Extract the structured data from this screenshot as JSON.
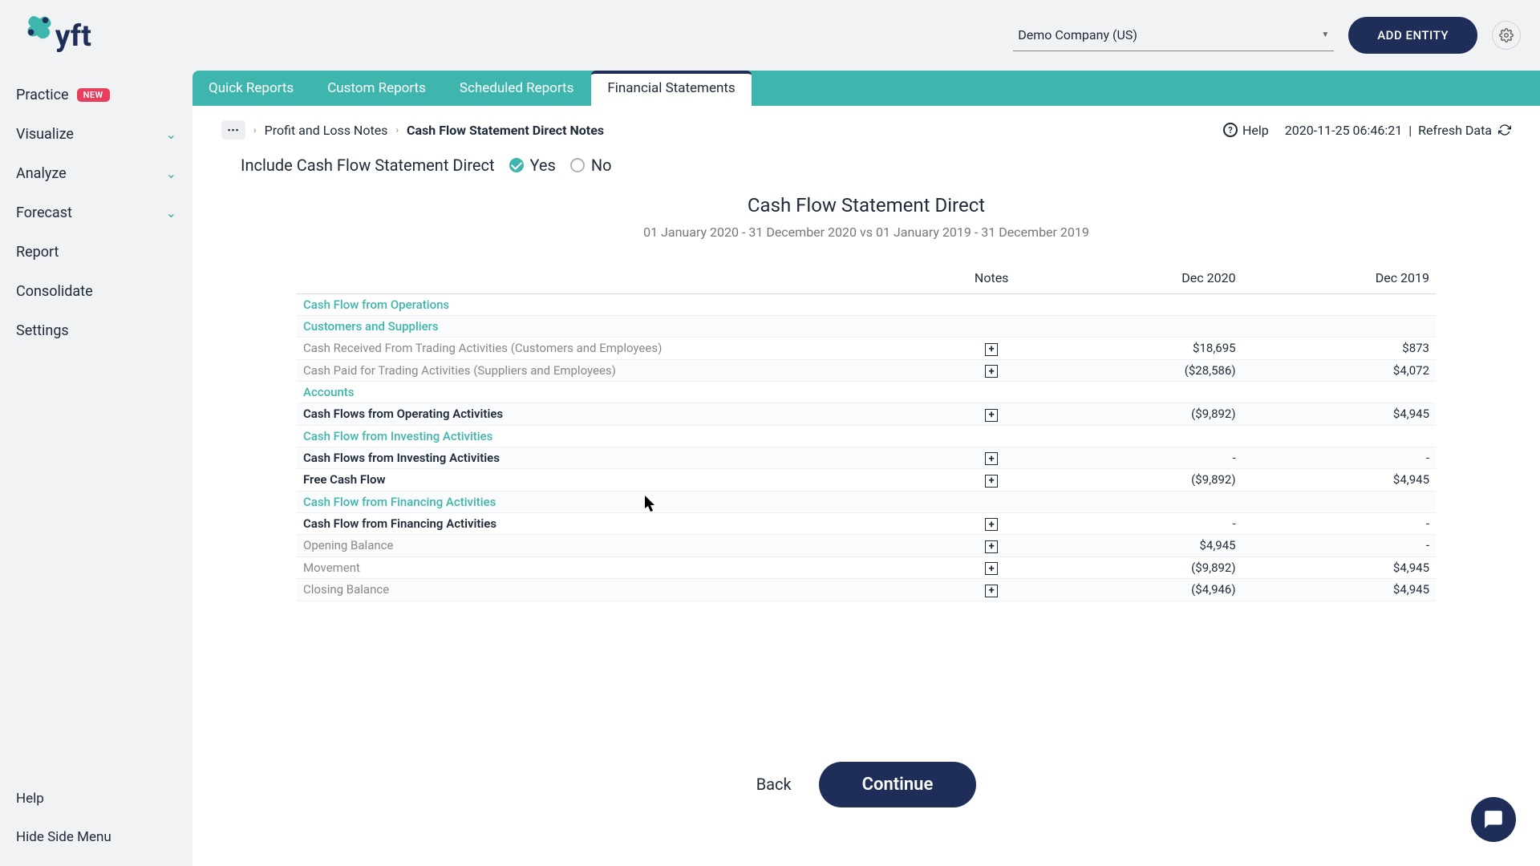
{
  "header": {
    "entity_selected": "Demo Company (US)",
    "add_entity_label": "ADD ENTITY"
  },
  "sidebar": {
    "items": [
      {
        "label": "Practice",
        "badge": "NEW",
        "chev": false
      },
      {
        "label": "Visualize",
        "badge": null,
        "chev": true
      },
      {
        "label": "Analyze",
        "badge": null,
        "chev": true
      },
      {
        "label": "Forecast",
        "badge": null,
        "chev": true
      },
      {
        "label": "Report",
        "badge": null,
        "chev": false
      },
      {
        "label": "Consolidate",
        "badge": null,
        "chev": false
      },
      {
        "label": "Settings",
        "badge": null,
        "chev": false
      }
    ],
    "help_label": "Help",
    "hide_label": "Hide Side Menu"
  },
  "tabs": [
    {
      "label": "Quick Reports",
      "active": false
    },
    {
      "label": "Custom Reports",
      "active": false
    },
    {
      "label": "Scheduled Reports",
      "active": false
    },
    {
      "label": "Financial Statements",
      "active": true
    }
  ],
  "breadcrumbs": {
    "prev": "Profit and Loss Notes",
    "current": "Cash Flow Statement Direct Notes"
  },
  "topbar": {
    "help_label": "Help",
    "timestamp": "2020-11-25 06:46:21",
    "refresh_label": "Refresh Data"
  },
  "include": {
    "label": "Include Cash Flow Statement Direct",
    "yes": "Yes",
    "no": "No",
    "selected": "yes"
  },
  "report": {
    "title": "Cash Flow Statement Direct",
    "period": "01 January 2020 - 31 December 2020 vs 01 January 2019 - 31 December 2019"
  },
  "table": {
    "headers": [
      "",
      "Notes",
      "Dec 2020",
      "Dec 2019"
    ],
    "rows": [
      {
        "type": "section",
        "label": "Cash Flow from Operations",
        "note": false,
        "c1": "",
        "c2": ""
      },
      {
        "type": "section",
        "label": "Customers and Suppliers",
        "note": false,
        "c1": "",
        "c2": "",
        "zebra": true
      },
      {
        "type": "detail",
        "label": "Cash Received From Trading Activities (Customers and Employees)",
        "note": true,
        "c1": "$18,695",
        "c2": "$873"
      },
      {
        "type": "detail",
        "label": "Cash Paid for Trading Activities (Suppliers and Employees)",
        "note": true,
        "c1": "($28,586)",
        "c2": "$4,072",
        "zebra": true
      },
      {
        "type": "section",
        "label": "Accounts",
        "note": false,
        "c1": "",
        "c2": ""
      },
      {
        "type": "total",
        "label": "Cash Flows from Operating Activities",
        "note": true,
        "c1": "($9,892)",
        "c2": "$4,945",
        "zebra": true
      },
      {
        "type": "section",
        "label": "Cash Flow from Investing Activities",
        "note": false,
        "c1": "",
        "c2": ""
      },
      {
        "type": "total",
        "label": "Cash Flows from Investing Activities",
        "note": true,
        "c1": "-",
        "c2": "-",
        "zebra": true
      },
      {
        "type": "total",
        "label": "Free Cash Flow",
        "note": true,
        "c1": "($9,892)",
        "c2": "$4,945"
      },
      {
        "type": "section",
        "label": "Cash Flow from Financing Activities",
        "note": false,
        "c1": "",
        "c2": "",
        "zebra": true
      },
      {
        "type": "total",
        "label": "Cash Flow from Financing Activities",
        "note": true,
        "c1": "-",
        "c2": "-"
      },
      {
        "type": "detail",
        "label": "Opening Balance",
        "note": true,
        "c1": "$4,945",
        "c2": "-",
        "zebra": true
      },
      {
        "type": "detail",
        "label": "Movement",
        "note": true,
        "c1": "($9,892)",
        "c2": "$4,945"
      },
      {
        "type": "detail",
        "label": "Closing Balance",
        "note": true,
        "c1": "($4,946)",
        "c2": "$4,945",
        "zebra": true
      }
    ]
  },
  "footer": {
    "back": "Back",
    "continue": "Continue"
  }
}
